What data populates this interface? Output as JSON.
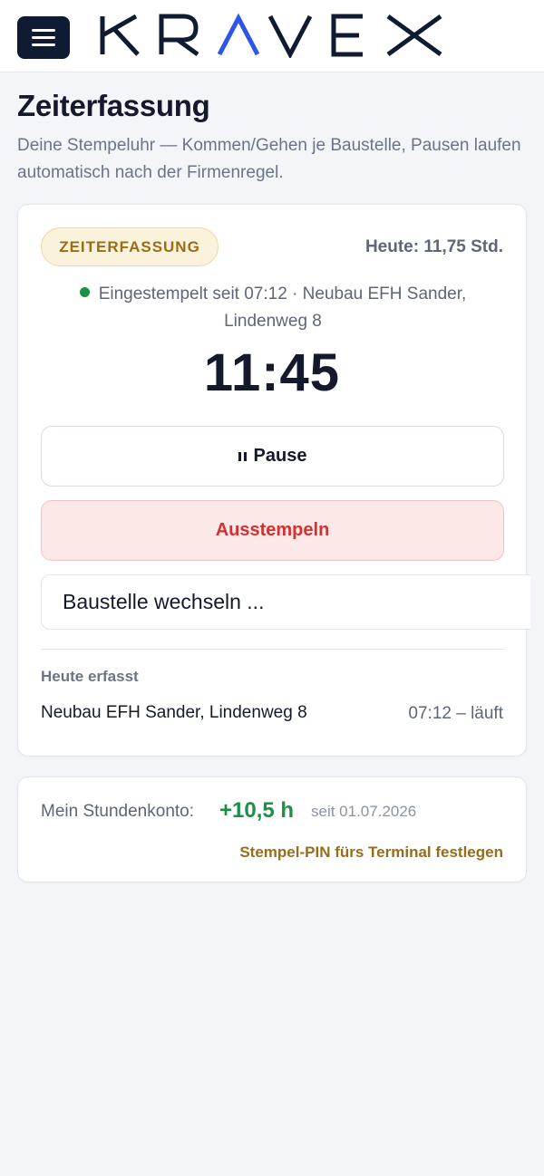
{
  "brand": {
    "logo_text": "KRAVEX"
  },
  "page": {
    "title": "Zeiterfassung",
    "subtitle": "Deine Stempeluhr — Kommen/Gehen je Baustelle, Pausen laufen automatisch nach der Firmenregel."
  },
  "clock_card": {
    "badge": "ZEITERFASSUNG",
    "today_total": "Heute: 11,75 Std.",
    "status_text": "Eingestempelt seit 07:12 · Neubau EFH Sander, Lindenweg 8",
    "timer": "11:45",
    "pause_label": "Pause",
    "clock_out_label": "Ausstempeln",
    "switch_site_placeholder": "Baustelle wechseln ...",
    "today_heading": "Heute erfasst",
    "entries": [
      {
        "site": "Neubau EFH Sander, Lindenweg 8",
        "time": "07:12 – läuft"
      }
    ]
  },
  "balance_card": {
    "label": "Mein Stundenkonto:",
    "value": "+10,5 h",
    "since": "seit 01.07.2026",
    "pin_link": "Stempel-PIN fürs Terminal festlegen"
  },
  "colors": {
    "nav_dark": "#0f1a33",
    "accent_blue": "#2f54eb",
    "status_green": "#1a9145",
    "danger_red": "#d3302f",
    "badge_gold": "#9a6c15"
  },
  "icons": [
    "menu-icon",
    "pause-icon",
    "status-dot-icon"
  ]
}
